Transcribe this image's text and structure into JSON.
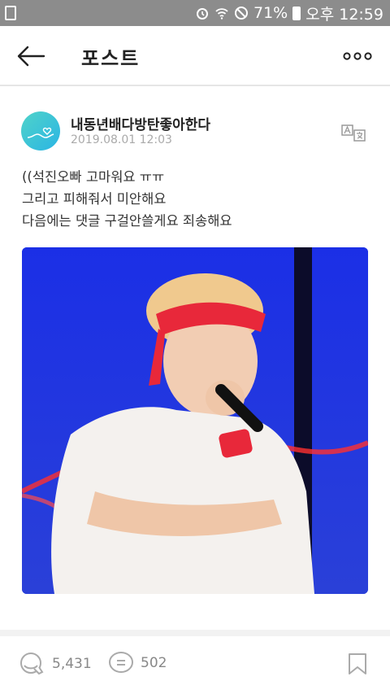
{
  "status_bar": {
    "battery": "71%",
    "time": "오후 12:59"
  },
  "header": {
    "title": "포스트"
  },
  "post": {
    "author": "내동년배다방탄좋아한다",
    "date": "2019.08.01 12:03",
    "lines": [
      "((석진오빠 고마워요 ㅠㅠ",
      "그리고 피해줘서 미안해요",
      "다음에는 댓글 구걸안쓸게요 죄송해요"
    ]
  },
  "footer": {
    "likes": "5,431",
    "comments": "502"
  },
  "colors": {
    "status_bar_bg": "#8c8c8c",
    "avatar_gradient_start": "#4fd3c9",
    "avatar_gradient_end": "#2bb5e4",
    "photo_background": "#1a2bd8",
    "headband_red": "#e8283a"
  }
}
